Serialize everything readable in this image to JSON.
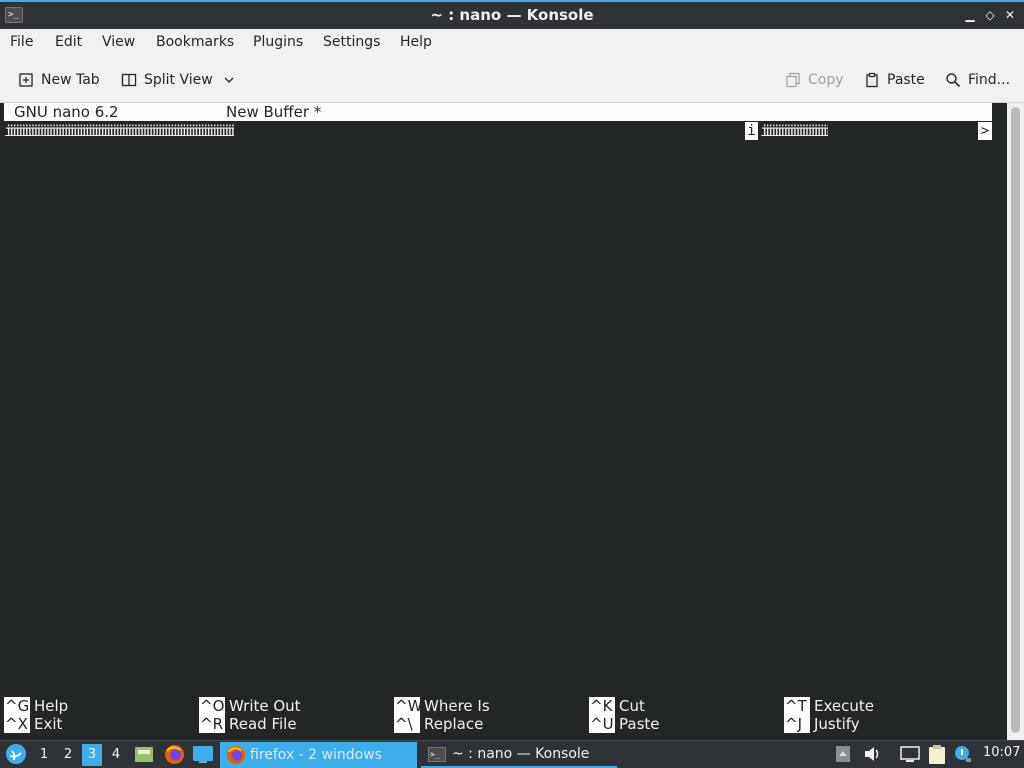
{
  "window": {
    "title": "~ : nano — Konsole"
  },
  "menu": [
    "File",
    "Edit",
    "View",
    "Bookmarks",
    "Plugins",
    "Settings",
    "Help"
  ],
  "toolbar": {
    "new_tab": "New Tab",
    "split_view": "Split View",
    "copy": "Copy",
    "paste": "Paste",
    "find": "Find..."
  },
  "nano": {
    "version": "GNU nano 6.2",
    "buffer": "New Buffer *",
    "line_left": "iiiiiiiiiiiiiiiiiiiiiiiiiiiiiiiiiiiiiiiiiiiiiiiiiiiiiiiiiiiiiiiiiiiiiiiiiiiiii",
    "cursor_char": "i",
    "line_right": "iiiiiiiiiiiiiiiiiiiiiiii",
    "more_indicator": ">",
    "shortcuts": [
      {
        "key": "^G",
        "label": "Help"
      },
      {
        "key": "^X",
        "label": "Exit"
      },
      {
        "key": "^O",
        "label": "Write Out"
      },
      {
        "key": "^R",
        "label": "Read File"
      },
      {
        "key": "^W",
        "label": "Where Is"
      },
      {
        "key": "^\\",
        "label": "Replace"
      },
      {
        "key": "^K",
        "label": "Cut"
      },
      {
        "key": "^U",
        "label": "Paste"
      },
      {
        "key": "^T",
        "label": "Execute"
      },
      {
        "key": "^J",
        "label": "Justify"
      }
    ]
  },
  "taskbar": {
    "desktops": [
      "1",
      "2",
      "3",
      "4"
    ],
    "active_desktop": "3",
    "tasks": {
      "firefox": "firefox - 2 windows",
      "konsole": "~ : nano — Konsole"
    },
    "clock": "10:07"
  },
  "colors": {
    "accent": "#3daee9",
    "terminal_bg": "#232627",
    "chrome_bg": "#eff0f1"
  }
}
